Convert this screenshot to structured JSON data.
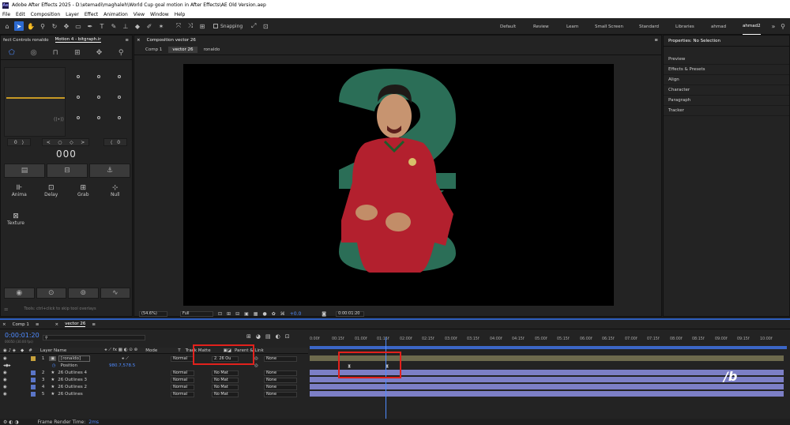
{
  "titlebar": {
    "logo": "Ae",
    "title": "Adobe After Effects 2025 - D:\\etemadi\\maghaleh\\World Cup goal motion in After Effects\\AE Old Version.aep"
  },
  "menu": [
    "File",
    "Edit",
    "Composition",
    "Layer",
    "Effect",
    "Animation",
    "View",
    "Window",
    "Help"
  ],
  "toolbar": {
    "snapping": "Snapping",
    "workspaces": [
      "Default",
      "Review",
      "Learn",
      "Small Screen",
      "Standard",
      "Libraries",
      "ahmad",
      "ahmad2"
    ],
    "active_workspace": "ahmad2"
  },
  "left_panel": {
    "tab1": "fect Controls ronaldo",
    "tab2": "Motion 4 - bitgraph.ir",
    "counter_left": "0",
    "counter_right": "0",
    "big_counter": "000",
    "buttons": [
      {
        "label": "Anima"
      },
      {
        "label": "Delay"
      },
      {
        "label": "Grab"
      },
      {
        "label": "Null"
      }
    ],
    "texture": "Texture",
    "hint": "Tools: ctrl+click to skip tool overlays"
  },
  "comp": {
    "header": "Composition vector 26",
    "crumbs": [
      "Comp 1",
      "vector 26",
      "ronaldo"
    ],
    "zoom": "(54.6%)",
    "resolution": "Full",
    "exposure": "+0.0",
    "timecode": "0:00:01:20",
    "accent": "#2b6e57"
  },
  "right_panel": {
    "title": "Properties: No Selection",
    "items": [
      "Preview",
      "Effects & Presets",
      "Align",
      "Character",
      "Paragraph",
      "Tracker"
    ]
  },
  "timeline": {
    "tabs": [
      "Comp 1",
      "vector 26"
    ],
    "timecode": "0:00:01:20",
    "timecode_sub": "00050 (30.00 fps)",
    "search_placeholder": "",
    "headers": {
      "num": "#",
      "layer": "Layer Name",
      "mode": "Mode",
      "t": "T",
      "matte": "Track Matte",
      "parent": "Parent & Link"
    },
    "ruler": [
      "0:00f",
      "00:15f",
      "01:00f",
      "01:15f",
      "02:00f",
      "02:15f",
      "03:00f",
      "03:15f",
      "04:00f",
      "04:15f",
      "05:00f",
      "05:15f",
      "06:00f",
      "06:15f",
      "07:00f",
      "07:15f",
      "08:00f",
      "08:15f",
      "09:00f",
      "09:15f",
      "10:00f"
    ],
    "layers": [
      {
        "num": "1",
        "name": "[ronaldo]",
        "mode": "Normal",
        "matte": "2. 26 Ou",
        "parent": "None",
        "color": "#c8a23c"
      },
      {
        "num": "2",
        "name": "26 Outlines 4",
        "mode": "Normal",
        "matte": "No Mat",
        "parent": "None",
        "color": "#5a75c7"
      },
      {
        "num": "3",
        "name": "26 Outlines 3",
        "mode": "Normal",
        "matte": "No Mat",
        "parent": "None",
        "color": "#5a75c7"
      },
      {
        "num": "4",
        "name": "26 Outlines 2",
        "mode": "Normal",
        "matte": "No Mat",
        "parent": "None",
        "color": "#5a75c7"
      },
      {
        "num": "5",
        "name": "26 Outlines",
        "mode": "Normal",
        "matte": "No Mat",
        "parent": "None",
        "color": "#5a75c7"
      }
    ],
    "position_label": "Position",
    "position_value": "980.7,578.5",
    "footer_label": "Frame Render Time:",
    "footer_value": "2ms",
    "playhead_pct": 0.16,
    "watermark": "/b"
  }
}
